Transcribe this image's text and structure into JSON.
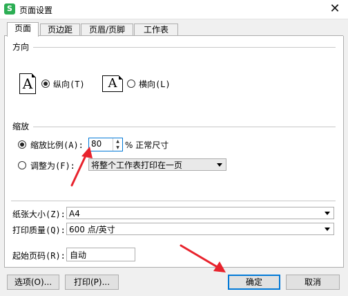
{
  "window": {
    "title": "页面设置",
    "app_icon_glyph": "S",
    "close_glyph": "✕"
  },
  "tabs": [
    {
      "label": "页面",
      "active": true
    },
    {
      "label": "页边距",
      "active": false
    },
    {
      "label": "页眉/页脚",
      "active": false
    },
    {
      "label": "工作表",
      "active": false
    }
  ],
  "orientation": {
    "section_label": "方向",
    "page_glyph": "A",
    "portrait_label": "纵向(T)",
    "landscape_label": "横向(L)",
    "selected": "portrait"
  },
  "scaling": {
    "section_label": "缩放",
    "scale_ratio_label": "缩放比例(A):",
    "scale_value": "80",
    "percent_suffix": "% 正常尺寸",
    "fit_to_label": "调整为(F):",
    "fit_to_value": "将整个工作表打印在一页",
    "selected": "scale_ratio"
  },
  "paper": {
    "paper_size_label": "纸张大小(Z):",
    "paper_size_value": "A4",
    "print_quality_label": "打印质量(Q):",
    "print_quality_value": "600 点/英寸"
  },
  "start_page": {
    "label": "起始页码(R):",
    "value": "自动"
  },
  "buttons": {
    "options": "选项(O)...",
    "print": "打印(P)...",
    "ok": "确定",
    "cancel": "取消"
  },
  "colors": {
    "accent": "#0078d7",
    "annotation_arrow": "#e8232d",
    "app_icon": "#2cae54"
  }
}
